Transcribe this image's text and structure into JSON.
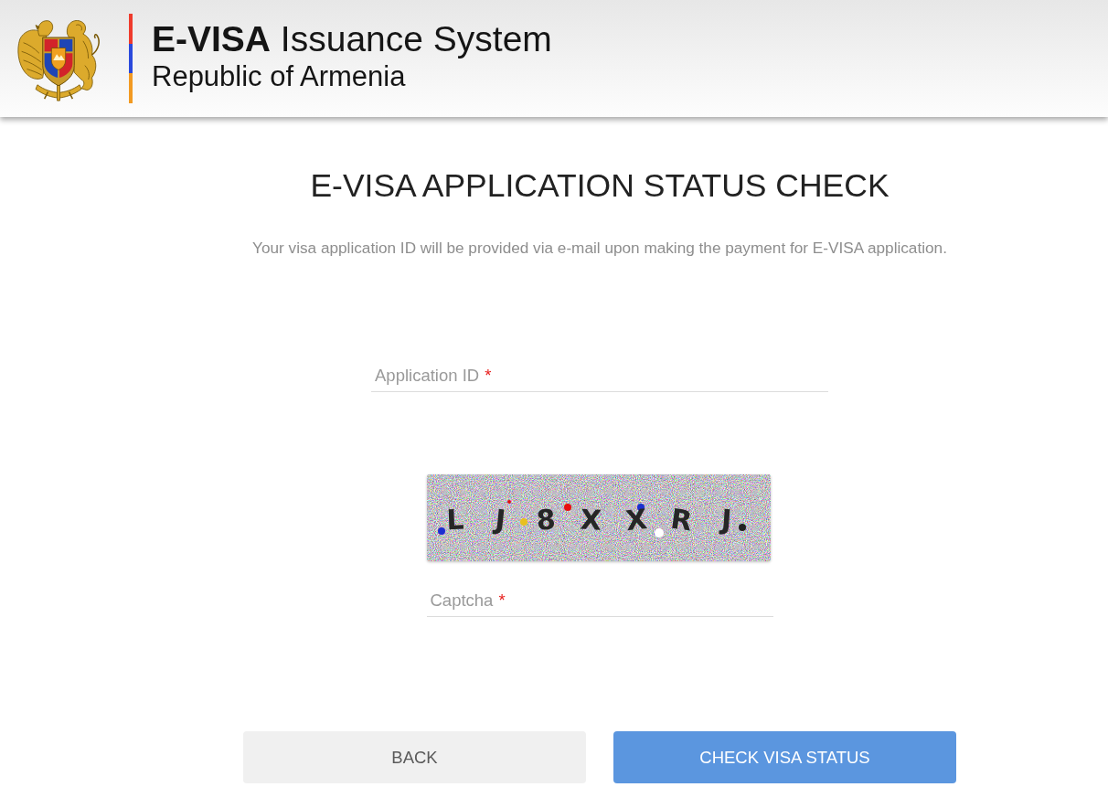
{
  "header": {
    "title": "**E-VISA** Issuance System",
    "subtitle": "Republic of Armenia"
  },
  "page": {
    "title": "E-VISA APPLICATION STATUS CHECK",
    "description": "Your visa application ID will be provided via e-mail upon making the payment for E-VISA application."
  },
  "form": {
    "application_id_field": {
      "label": "Application ID",
      "required_mark": "*"
    },
    "captcha": {
      "characters": [
        "L",
        "J",
        "8",
        "X",
        "X",
        "R",
        "J"
      ]
    },
    "captcha_field": {
      "label": "Captcha",
      "required_mark": "*"
    }
  },
  "buttons": [
    {
      "label": "BACK",
      "kind": "secondary"
    },
    {
      "label": "CHECK VISA STATUS",
      "kind": "primary"
    }
  ]
}
